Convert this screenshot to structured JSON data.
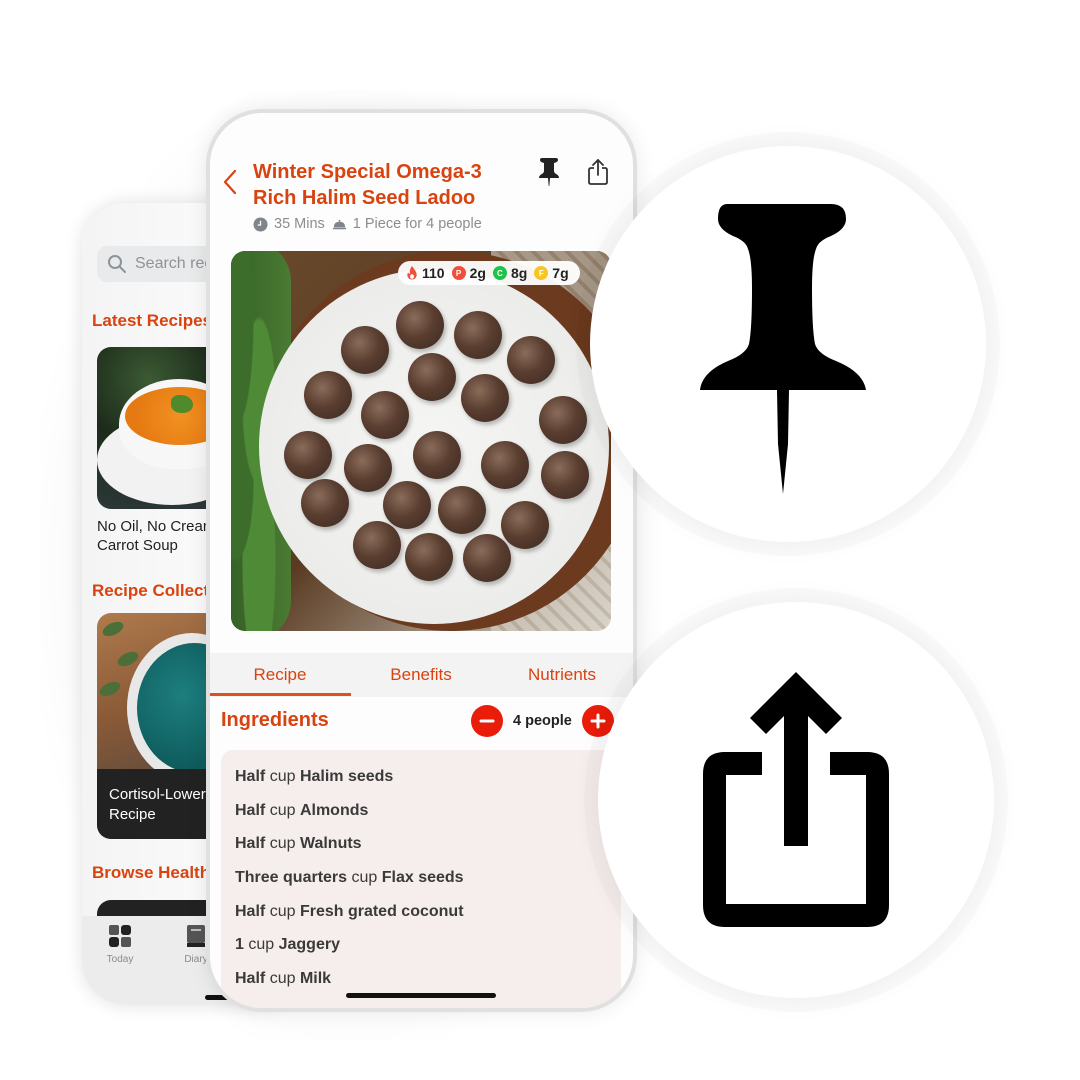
{
  "colors": {
    "brand_orange": "#d9430f",
    "stepper_red": "#ea1c0a",
    "protein": "#ef4f3b",
    "carbs": "#1fc24a",
    "fat": "#f7c623",
    "ingredients_bg": "#f6eeec"
  },
  "back_screen": {
    "search_placeholder": "Search recipes",
    "sections": {
      "latest": "Latest Recipes",
      "collections": "Recipe Collections",
      "browse": "Browse Healthy"
    },
    "cards": [
      {
        "title_line1": "No Oil, No Cream",
        "title_line2": "Carrot Soup"
      },
      {
        "title_line1": "Cortisol-Lowering",
        "title_line2": "Recipe"
      }
    ],
    "tab_bar": [
      {
        "label": "Today",
        "icon": "grid-icon"
      },
      {
        "label": "Diary",
        "icon": "diary-icon"
      }
    ]
  },
  "recipe": {
    "title": "Winter Special Omega-3 Rich Halim Seed Ladoo",
    "time": "35 Mins",
    "serving": "1 Piece for 4 people",
    "macros": {
      "calories": "110",
      "protein_label": "P",
      "protein": "2g",
      "carbs_label": "C",
      "carbs": "8g",
      "fat_label": "F",
      "fat": "7g"
    },
    "tabs": [
      {
        "label": "Recipe",
        "active": true
      },
      {
        "label": "Benefits",
        "active": false
      },
      {
        "label": "Nutrients",
        "active": false
      }
    ],
    "ingredients_heading": "Ingredients",
    "people": "4 people",
    "ingredients": [
      {
        "qty": "Half",
        "unit": "cup",
        "name": "Halim seeds"
      },
      {
        "qty": "Half",
        "unit": "cup",
        "name": "Almonds"
      },
      {
        "qty": "Half",
        "unit": "cup",
        "name": "Walnuts"
      },
      {
        "qty": "Three quarters",
        "unit": "cup",
        "name": "Flax seeds"
      },
      {
        "qty": "Half",
        "unit": "cup",
        "name": "Fresh grated coconut"
      },
      {
        "qty": "1",
        "unit": "cup",
        "name": "Jaggery"
      },
      {
        "qty": "Half",
        "unit": "cup",
        "name": "Milk"
      }
    ]
  },
  "callouts": [
    {
      "icon": "pushpin-icon"
    },
    {
      "icon": "share-icon"
    }
  ]
}
